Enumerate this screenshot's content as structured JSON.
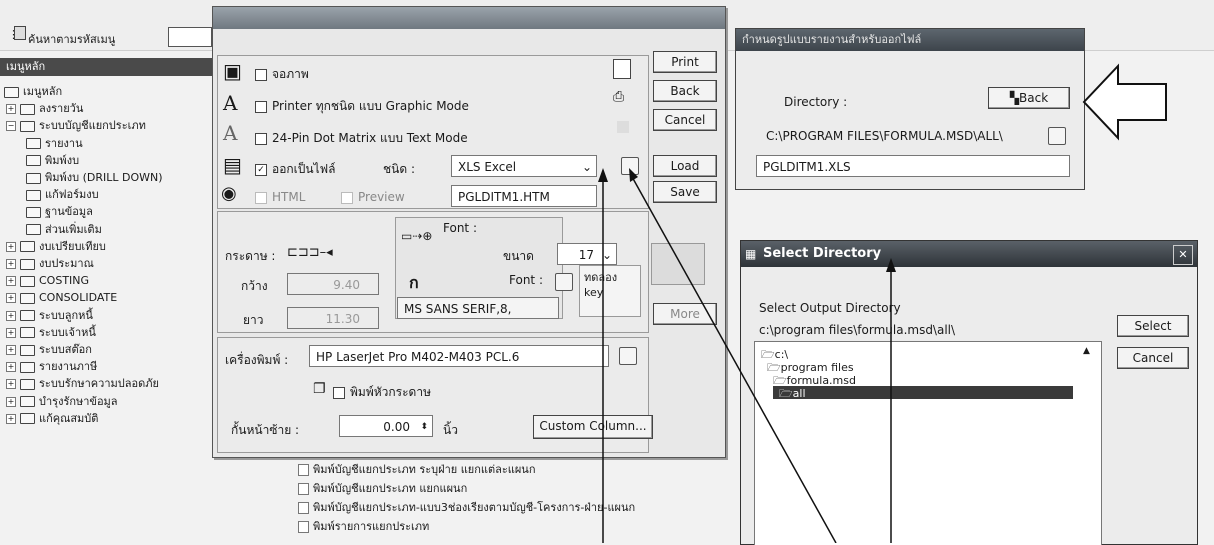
{
  "toolbar": {
    "search_label": "ค้นหาตามรหัสเมนู"
  },
  "tree": {
    "header": "เมนูหลัก",
    "items": [
      {
        "label": "เมนูหลัก",
        "level": 0
      },
      {
        "label": "ลงรายวัน",
        "level": 1,
        "pm": "+"
      },
      {
        "label": "ระบบบัญชีแยกประเภท",
        "level": 1,
        "pm": "−"
      },
      {
        "label": "รายงาน",
        "level": 2
      },
      {
        "label": "พิมพ์งบ",
        "level": 2
      },
      {
        "label": "พิมพ์งบ (DRILL DOWN)",
        "level": 2
      },
      {
        "label": "แก้ฟอร์มงบ",
        "level": 2
      },
      {
        "label": "ฐานข้อมูล",
        "level": 2
      },
      {
        "label": "ส่วนเพิ่มเติม",
        "level": 2
      },
      {
        "label": "งบเปรียบเทียบ",
        "level": 1,
        "pm": "+"
      },
      {
        "label": "งบประมาณ",
        "level": 1,
        "pm": "+"
      },
      {
        "label": "COSTING",
        "level": 1,
        "pm": "+"
      },
      {
        "label": "CONSOLIDATE",
        "level": 1,
        "pm": "+"
      },
      {
        "label": "ระบบลูกหนี้",
        "level": 1,
        "pm": "+"
      },
      {
        "label": "ระบบเจ้าหนี้",
        "level": 1,
        "pm": "+"
      },
      {
        "label": "ระบบสต๊อก",
        "level": 1,
        "pm": "+"
      },
      {
        "label": "รายงานภาษี",
        "level": 1,
        "pm": "+"
      },
      {
        "label": "ระบบรักษาความปลอดภัย",
        "level": 1,
        "pm": "+"
      },
      {
        "label": "บำรุงรักษาข้อมูล",
        "level": 1,
        "pm": "+"
      },
      {
        "label": "แก้คุณสมบัติ",
        "level": 1,
        "pm": "+"
      }
    ]
  },
  "print_dialog": {
    "opt_screen": "จอภาพ",
    "opt_graphic": "Printer ทุกชนิด แบบ Graphic Mode",
    "opt_text": "24-Pin Dot Matrix แบบ Text Mode",
    "opt_file": "ออกเป็นไฟล์",
    "opt_html": "HTML",
    "opt_preview": "Preview",
    "type_label": "ชนิด :",
    "type_value": "XLS Excel",
    "filename": "PGLDITM1.HTM",
    "buttons": {
      "print": "Print",
      "back": "Back",
      "cancel": "Cancel",
      "load": "Load",
      "save": "Save",
      "more": "More"
    },
    "paper_label": "กระดาษ :",
    "width_label": "กว้าง",
    "width_value": "9.40",
    "length_label": "ยาว",
    "length_value": "11.30",
    "font_label": "Font :",
    "size_label": "ขนาด",
    "size_value": "17",
    "font_label2": "Font :",
    "font_value": "MS SANS SERIF,8,",
    "sample_text": "ทดลอง\nkey",
    "printer_label": "เครื่องพิมพ์ :",
    "printer_value": "HP LaserJet Pro M402-M403 PCL.6",
    "print_header": "พิมพ์หัวกระดาษ",
    "margin_label": "กั้นหน้าซ้าย :",
    "margin_value": "0.00",
    "margin_unit": "นิ้ว",
    "custom_column": "Custom Column..."
  },
  "report_list": [
    "พิมพ์บัญชีแยกประเภท ระบุฝ่าย แยกแต่ละแผนก",
    "พิมพ์บัญชีแยกประเภท แยกแผนก",
    "พิมพ์บัญชีแยกประเภท-แบบ3ช่องเรียงตามบัญชี-โครงการ-ฝ่าย-แผนก",
    "พิมพ์รายการแยกประเภท"
  ],
  "file_dialog": {
    "title": "กำหนดรูปแบบรายงานสำหรับออกไฟล์",
    "directory_label": "Directory :",
    "back": "Back",
    "directory_value": "C:\\PROGRAM FILES\\FORMULA.MSD\\ALL\\",
    "file_value": "PGLDITM1.XLS"
  },
  "select_dir": {
    "title": "Select Directory",
    "prompt": "Select Output Directory",
    "path": "c:\\program files\\formula.msd\\all\\",
    "items": [
      "c:\\",
      "program files",
      "formula.msd",
      "all"
    ],
    "select": "Select",
    "cancel": "Cancel"
  }
}
